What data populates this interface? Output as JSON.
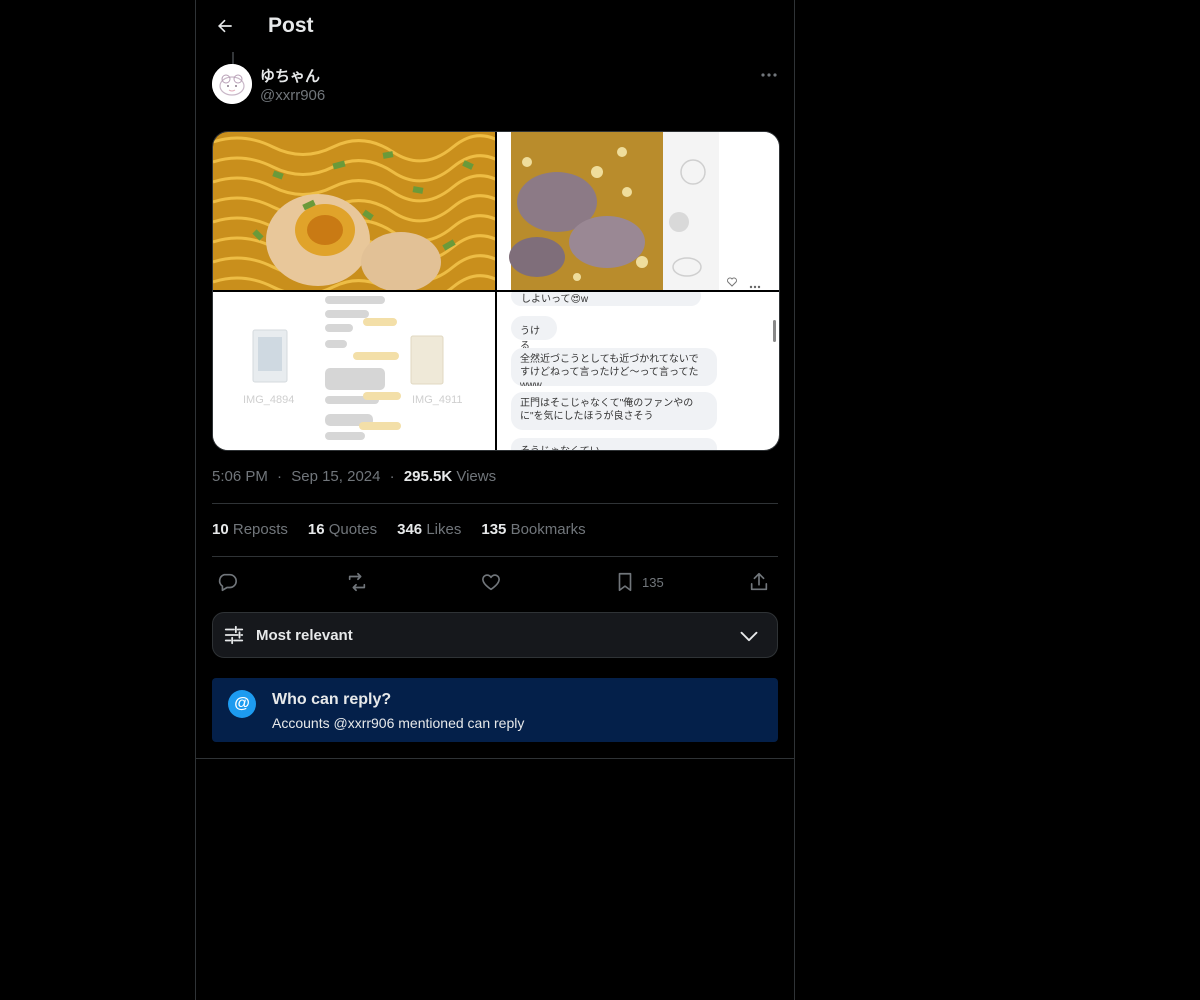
{
  "header": {
    "title": "Post",
    "back_icon": "arrow-left-icon"
  },
  "author": {
    "display_name": "ゆちゃん",
    "handle": "@xxrr906"
  },
  "media": {
    "tile2": {
      "caption_icons": [
        "heart-icon",
        "more-icon"
      ]
    },
    "tile3": {
      "file_left": "IMG_4894",
      "file_right": "IMG_4911"
    },
    "tile4": {
      "bubbles": [
        "しよいって😍w",
        "うける",
        "全然近づこうとしても近づかれてないですけどねって言ったけど〜って言ってたwww",
        "正門はそこじゃなくて\"俺のファンやのに\"を気にしたほうが良さそう",
        "そうじゃなくてい…"
      ]
    }
  },
  "meta": {
    "time": "5:06 PM",
    "date": "Sep 15, 2024",
    "views_count": "295.5K",
    "views_label": "Views",
    "separator": "·"
  },
  "stats": {
    "reposts_count": "10",
    "reposts_label": "Reposts",
    "quotes_count": "16",
    "quotes_label": "Quotes",
    "likes_count": "346",
    "likes_label": "Likes",
    "bookmarks_count": "135",
    "bookmarks_label": "Bookmarks"
  },
  "actions": {
    "bookmark_count": "135"
  },
  "sort": {
    "label": "Most relevant"
  },
  "reply_notice": {
    "icon": "@",
    "title": "Who can reply?",
    "subtitle": "Accounts @xxrr906 mentioned can reply"
  },
  "colors": {
    "accent": "#1d9bf0",
    "notice_bg": "#04204a",
    "muted": "#71767b"
  }
}
